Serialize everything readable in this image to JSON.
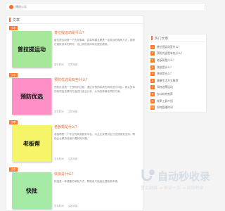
{
  "notice": {
    "text": "播放公告"
  },
  "main": {
    "header": "文章"
  },
  "articles": [
    {
      "tag": "文章",
      "thumb_label": "普拉提运动",
      "thumb_color": "#a7e79a",
      "title": "普拉提运动是什么？",
      "summary": "普拉提运动是一个比较简单、容易掌握且兼具一定挑战的锻炼方式，能够在锻炼身体的同时，也让你的身体体态更加健美。",
      "meta": [
        "发布时间",
        "文章来源"
      ]
    },
    {
      "tag": "文章",
      "thumb_label": "预防优选",
      "thumb_color": "#ff8fc7",
      "title": "预防优选是有些什么？",
      "summary": "预防优选是一个预防的过程，通过对预防疾病的风险进行评估，再从身体的各项检查情况方面进行综合分析，从而选择最佳预防方案。",
      "meta": [
        "发布时间",
        "文章来源"
      ]
    },
    {
      "tag": "文章",
      "thumb_label": "老板帮",
      "thumb_color": "#f6f56a",
      "title": "老板帮是什么？",
      "summary": "老板帮是一个专业的商务服务平台，为企业家提供全方位的服务支持，帮助企业解决经营中遇到的问题。",
      "meta": [
        "发布时间",
        "文章来源"
      ]
    },
    {
      "tag": "文章",
      "thumb_label": "快批",
      "thumb_color": "#a4e9a4",
      "title": "快批是什么？",
      "summary": "快批是一种便捷的审批方式，帮助用户快速处理各类申请。",
      "meta": [
        "发布时间",
        "文章来源"
      ]
    }
  ],
  "sidebar": {
    "header": "热门文章",
    "items": [
      "普拉提运动是什么？",
      "预防优选是有些什么？",
      "老板帮是什么？",
      "快批是什么？",
      "快批是什么？",
      "健康生活方式推荐",
      "如何选择运动",
      "办公软件推荐",
      "效率工具介绍",
      "如何管理时间",
      "智能办公新趋势"
    ]
  },
  "watermark": {
    "title": "自动秒收录",
    "subtitle": "登上链接 → 来访一次 → 自动收录"
  },
  "colors": {
    "accent": "#ff7a2b"
  }
}
